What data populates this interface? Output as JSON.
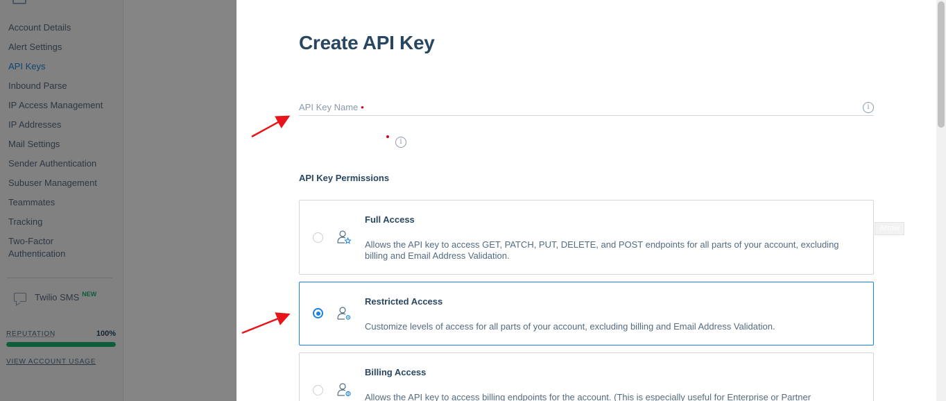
{
  "sidebar": {
    "items": [
      {
        "label": "Account Details",
        "active": false
      },
      {
        "label": "Alert Settings",
        "active": false
      },
      {
        "label": "API Keys",
        "active": true
      },
      {
        "label": "Inbound Parse",
        "active": false
      },
      {
        "label": "IP Access Management",
        "active": false
      },
      {
        "label": "IP Addresses",
        "active": false
      },
      {
        "label": "Mail Settings",
        "active": false
      },
      {
        "label": "Sender Authentication",
        "active": false
      },
      {
        "label": "Subuser Management",
        "active": false
      },
      {
        "label": "Teammates",
        "active": false
      },
      {
        "label": "Tracking",
        "active": false
      },
      {
        "label": "Two-Factor Authentication",
        "active": false
      }
    ],
    "sms": {
      "label": "Twilio SMS",
      "badge": "NEW"
    },
    "reputation": {
      "label": "REPUTATION",
      "value": "100%",
      "fraction": 1.0
    },
    "usage_link": "VIEW ACCOUNT USAGE"
  },
  "main": {
    "title": "Create API Key",
    "name_field": {
      "label": "API Key Name",
      "required_mark": "•",
      "value": ""
    },
    "permissions": {
      "title": "API Key Permissions",
      "options": [
        {
          "title": "Full Access",
          "description": "Allows the API key to access GET, PATCH, PUT, DELETE, and POST endpoints for all parts of your account, excluding billing and Email Address Validation.",
          "selected": false
        },
        {
          "title": "Restricted Access",
          "description": "Customize levels of access for all parts of your account, excluding billing and Email Address Validation.",
          "selected": true
        },
        {
          "title": "Billing Access",
          "description": "Allows the API key to access billing endpoints for the account. (This is especially useful for Enterprise or Partner",
          "selected": false
        }
      ]
    },
    "tooltip": "Arrow"
  },
  "colors": {
    "accent": "#1a82e2",
    "heading": "#294661",
    "annotation": "#e8141a",
    "success": "#19b06f"
  }
}
